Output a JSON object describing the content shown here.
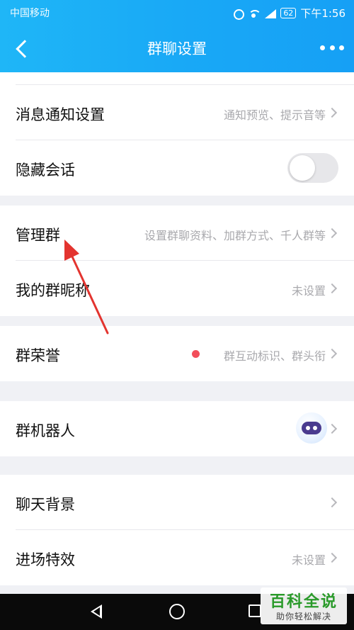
{
  "status_bar": {
    "carrier": "中国移动",
    "battery": "62",
    "time": "下午1:56"
  },
  "nav": {
    "title": "群聊设置"
  },
  "rows": {
    "notify": {
      "label": "消息通知设置",
      "value": "通知预览、提示音等"
    },
    "hide": {
      "label": "隐藏会话",
      "toggle_on": false
    },
    "manage": {
      "label": "管理群",
      "value": "设置群聊资料、加群方式、千人群等"
    },
    "nickname": {
      "label": "我的群昵称",
      "value": "未设置"
    },
    "honor": {
      "label": "群荣誉",
      "value": "群互动标识、群头衔"
    },
    "robot": {
      "label": "群机器人"
    },
    "background": {
      "label": "聊天背景"
    },
    "effect": {
      "label": "进场特效",
      "value": "未设置"
    }
  },
  "watermark": {
    "title": "百科全说",
    "subtitle": "助你轻松解决"
  },
  "colors": {
    "header_start": "#1fb6f7",
    "header_end": "#16a0f5",
    "annotation_arrow": "#e3342f",
    "badge_dot": "#f24e5a"
  }
}
